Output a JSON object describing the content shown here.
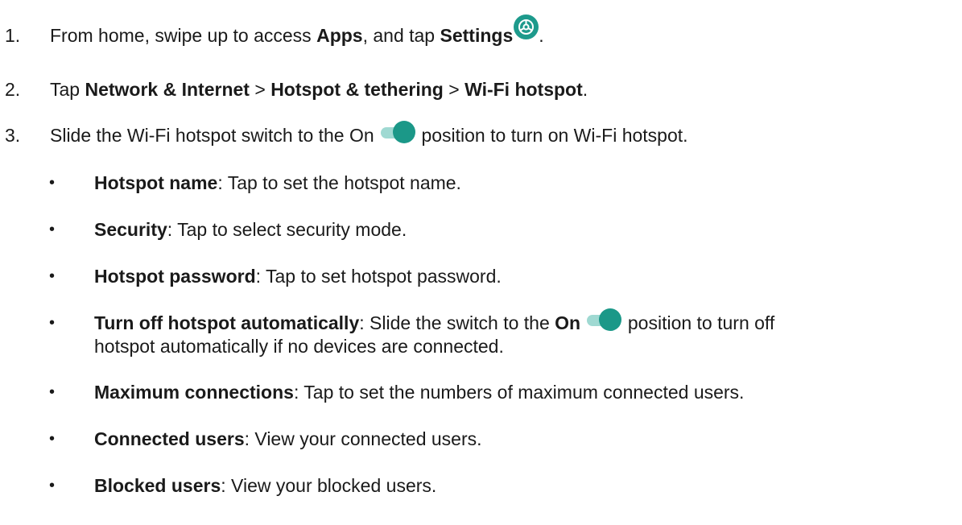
{
  "steps": [
    {
      "number": "1.",
      "pre": "From home, swipe up to access ",
      "b1": "Apps",
      "mid": ", and tap ",
      "b2": "Settings",
      "icon": "settings-gear-icon",
      "post": "."
    },
    {
      "number": "2.",
      "pre": "Tap ",
      "b1": "Network & Internet",
      "sep1": " > ",
      "b2": "Hotspot & tethering",
      "sep2": " > ",
      "b3": "Wi-Fi hotspot",
      "post": "."
    },
    {
      "number": "3.",
      "pre": "Slide the Wi-Fi hotspot switch to the On ",
      "icon": "toggle-switch-on-icon",
      "post": " position to turn on Wi-Fi hotspot."
    }
  ],
  "bullets": [
    {
      "dot": "•",
      "term": "Hotspot name",
      "desc": ": Tap to set the hotspot name."
    },
    {
      "dot": "•",
      "term": "Security",
      "desc": ": Tap to select security mode."
    },
    {
      "dot": "•",
      "term": "Hotspot password",
      "desc": ": Tap to set hotspot password."
    },
    {
      "dot": "•",
      "term": "Turn off hotspot automatically",
      "desc_a": ": Slide the switch to the ",
      "on": "On",
      "desc_b": " position to turn off",
      "desc_line2": "hotspot automatically if no devices are connected."
    },
    {
      "dot": "•",
      "term": "Maximum connections",
      "desc": ": Tap to set the numbers of maximum connected users."
    },
    {
      "dot": "•",
      "term": "Connected users",
      "desc": ": View your connected users."
    },
    {
      "dot": "•",
      "term": "Blocked users",
      "desc": ": View your blocked users."
    }
  ],
  "colors": {
    "accent": "#1b9888",
    "toggle_track": "#9fd9d2",
    "text": "#1a1a1a"
  }
}
